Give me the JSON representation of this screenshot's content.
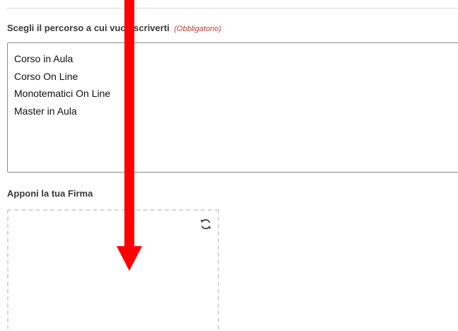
{
  "path_field": {
    "label": "Scegli il percorso a cui vuoi iscriverti",
    "required_note": "(Obbligatorio)",
    "options": [
      "Corso in Aula",
      "Corso On Line",
      "Monotematici On Line",
      "Master in Aula"
    ]
  },
  "signature_field": {
    "label": "Apponi la tua Firma",
    "reset_icon": "refresh-icon"
  },
  "annotation": {
    "type": "arrow",
    "color": "#ff0000",
    "direction": "down"
  },
  "colors": {
    "required_note": "#c0392b",
    "border": "#8a8a8a",
    "dashed_border": "#d6d6d6"
  }
}
